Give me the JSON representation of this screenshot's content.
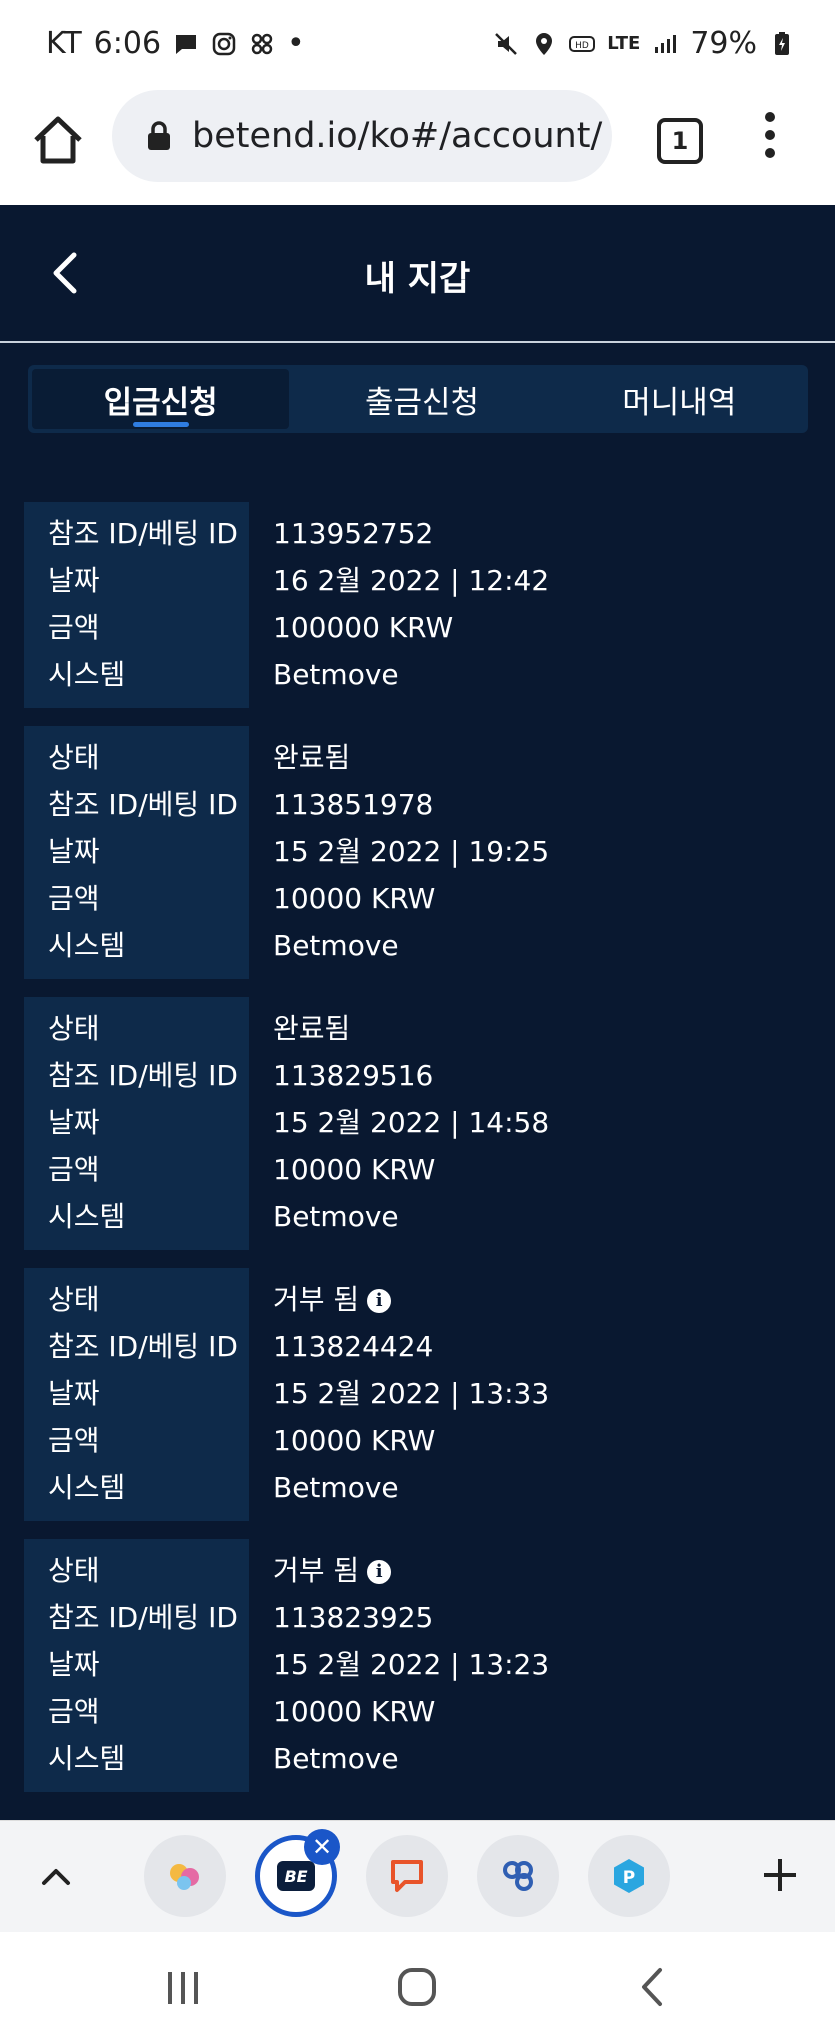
{
  "status_bar": {
    "carrier": "KT",
    "time": "6:06",
    "dot": "•",
    "network": "LTE",
    "battery": "79%"
  },
  "browser": {
    "url": "betend.io/ko#/account/",
    "tab_count": "1"
  },
  "header": {
    "title": "내 지갑"
  },
  "tabs": [
    {
      "label": "입금신청",
      "active": true
    },
    {
      "label": "출금신청",
      "active": false
    },
    {
      "label": "머니내역",
      "active": false
    }
  ],
  "records": [
    {
      "labels": [
        "참조 ID/베팅 ID",
        "날짜",
        "금액",
        "시스템"
      ],
      "values": [
        "113952752",
        "16 2월 2022 | 12:42",
        "100000 KRW",
        "Betmove"
      ]
    },
    {
      "labels": [
        "상태",
        "참조 ID/베팅 ID",
        "날짜",
        "금액",
        "시스템"
      ],
      "values": [
        "완료됨",
        "113851978",
        "15 2월 2022 | 19:25",
        "10000 KRW",
        "Betmove"
      ]
    },
    {
      "labels": [
        "상태",
        "참조 ID/베팅 ID",
        "날짜",
        "금액",
        "시스템"
      ],
      "values": [
        "완료됨",
        "113829516",
        "15 2월 2022 | 14:58",
        "10000 KRW",
        "Betmove"
      ]
    },
    {
      "labels": [
        "상태",
        "참조 ID/베팅 ID",
        "날짜",
        "금액",
        "시스템"
      ],
      "values": [
        "거부 됨",
        "113824424",
        "15 2월 2022 | 13:33",
        "10000 KRW",
        "Betmove"
      ],
      "status_info": true
    },
    {
      "labels": [
        "상태",
        "참조 ID/베팅 ID",
        "날짜",
        "금액",
        "시스템"
      ],
      "values": [
        "거부 됨",
        "113823925",
        "15 2월 2022 | 13:23",
        "10000 KRW",
        "Betmove"
      ],
      "status_info": true
    }
  ],
  "bottom_bar": {
    "active_tab_logo": "BE",
    "close_glyph": "✕",
    "info_glyph": "i"
  },
  "colors": {
    "background": "#091830",
    "panel": "#0e2a4a",
    "accent": "#2f7de1",
    "tab_ring": "#1a56c8"
  }
}
